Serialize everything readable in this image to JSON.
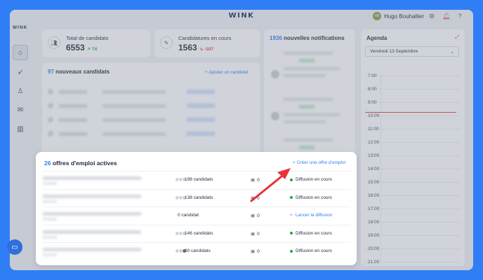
{
  "header": {
    "brand": "WINK",
    "user_initials": "HB",
    "user_name": "Hugo Bouhallier"
  },
  "sidebar": {
    "logo": "WINK"
  },
  "stats": [
    {
      "label": "Total de candidats",
      "value": "6553",
      "trend": "74",
      "direction": "up"
    },
    {
      "label": "Candidatures en cours",
      "value": "1563",
      "trend": "-107",
      "direction": "down"
    }
  ],
  "candidates": {
    "count": "97",
    "title": "nouveaux candidats",
    "add_link": "+ Ajouter un candidat"
  },
  "notifications": {
    "count": "1936",
    "title": "nouvelles notifications"
  },
  "agenda": {
    "title": "Agenda",
    "date": "Vendredi 13 Septembre",
    "hours": [
      "7:00",
      "8:00",
      "9:00",
      "10:00",
      "11:00",
      "12:00",
      "13:00",
      "14:00",
      "15:00",
      "16:00",
      "17:00",
      "18:00",
      "19:00",
      "20:00",
      "21:00"
    ]
  },
  "jobs": {
    "count": "26",
    "title": "offres d'emploi actives",
    "create_link": "+ Créer une offre d'emploi",
    "rows": [
      {
        "candidates": "198 candidats",
        "messages": "0",
        "status": "Diffusion en cours",
        "kind": "active"
      },
      {
        "candidates": "138 candidats",
        "messages": "0",
        "status": "Diffusion en cours",
        "kind": "active"
      },
      {
        "candidates": "0 candidat",
        "messages": "0",
        "status": "Lancer la diffusion",
        "kind": "launch"
      },
      {
        "candidates": "146 candidats",
        "messages": "0",
        "status": "Diffusion en cours",
        "kind": "active"
      },
      {
        "candidates": "90 candidats",
        "messages": "0",
        "status": "Diffusion en cours",
        "kind": "active"
      }
    ]
  },
  "colors": {
    "accent": "#2f7ef5",
    "background": "#2f7ef5",
    "success": "#1fa84a",
    "danger": "#e0403a",
    "annotation_arrow": "#e8323a"
  }
}
